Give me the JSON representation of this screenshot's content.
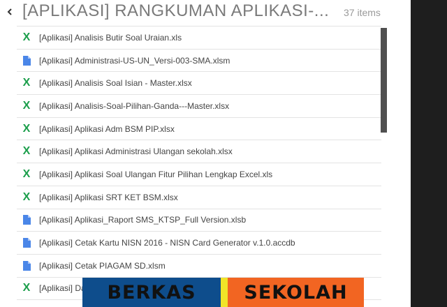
{
  "header": {
    "back_icon": "chevron-left-icon",
    "title": "[APLIKASI] RANGKUMAN APLIKASI-...",
    "item_count": "37 items"
  },
  "colors": {
    "xls_icon": "#1b9e4b",
    "doc_icon": "#4a86e8",
    "banner_left": "#0e4d8c",
    "banner_divider": "#f1e428",
    "banner_right": "#f26522"
  },
  "files": [
    {
      "icon": "excel-icon",
      "name": "[Aplikasi] Analisis Butir Soal Uraian.xls"
    },
    {
      "icon": "document-icon",
      "name": "[Aplikasi] Administrasi-US-UN_Versi-003-SMA.xlsm"
    },
    {
      "icon": "excel-icon",
      "name": "[Aplikasi] Analisis Soal Isian - Master.xlsx"
    },
    {
      "icon": "excel-icon",
      "name": "[Aplikasi] Analisis-Soal-Pilihan-Ganda---Master.xlsx"
    },
    {
      "icon": "excel-icon",
      "name": "[Aplikasi] Aplikasi Adm BSM PIP.xlsx"
    },
    {
      "icon": "excel-icon",
      "name": "[Aplikasi] Aplikasi Administrasi Ulangan sekolah.xlsx"
    },
    {
      "icon": "excel-icon",
      "name": "[Aplikasi] Aplikasi Soal Ulangan Fitur Pilihan Lengkap Excel.xls"
    },
    {
      "icon": "excel-icon",
      "name": "[Aplikasi] Aplikasi SRT KET BSM.xlsx"
    },
    {
      "icon": "document-icon",
      "name": "[Aplikasi] Aplikasi_Raport SMS_KTSP_Full Version.xlsb"
    },
    {
      "icon": "document-icon",
      "name": "[Aplikasi] Cetak Kartu NISN 2016 - NISN Card Generator v.1.0.accdb"
    },
    {
      "icon": "document-icon",
      "name": "[Aplikasi] Cetak PIAGAM SD.xlsm"
    },
    {
      "icon": "excel-icon",
      "name": "[Aplikasi] Da"
    }
  ],
  "banner": {
    "left_text": "BERKAS",
    "right_text": "SEKOLAH"
  }
}
